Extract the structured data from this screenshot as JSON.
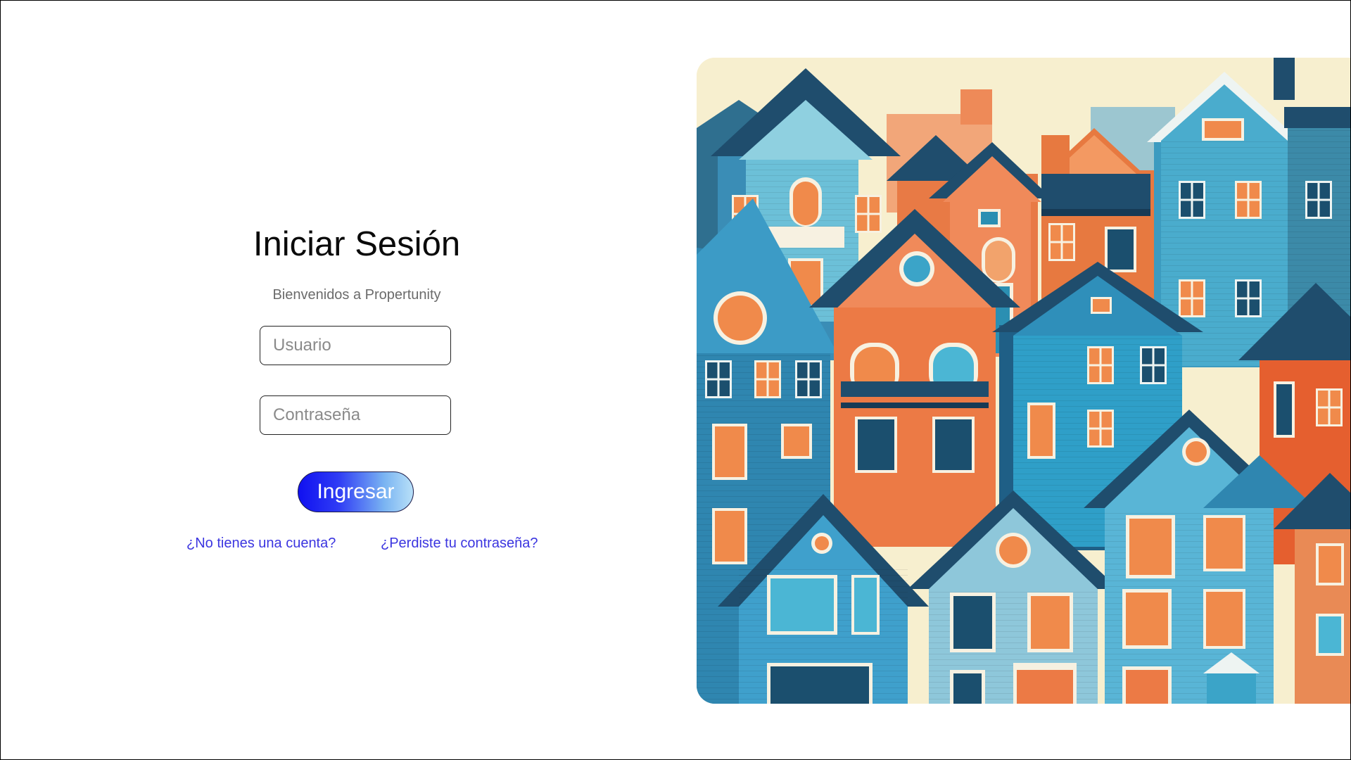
{
  "login": {
    "title": "Iniciar Sesión",
    "subtitle": "Bienvenidos a Propertunity",
    "username_placeholder": "Usuario",
    "password_placeholder": "Contraseña",
    "submit_label": "Ingresar",
    "register_link": "¿No tienes una cuenta?",
    "forgot_link": "¿Perdiste tu contraseña?"
  },
  "colors": {
    "link": "#3b35e0",
    "button_gradient_start": "#1010f0",
    "button_gradient_end": "#b8e0f8",
    "title": "#0a0a0a",
    "subtitle": "#6b6b6b"
  },
  "illustration": {
    "subject": "colorful-houses-illustration"
  }
}
